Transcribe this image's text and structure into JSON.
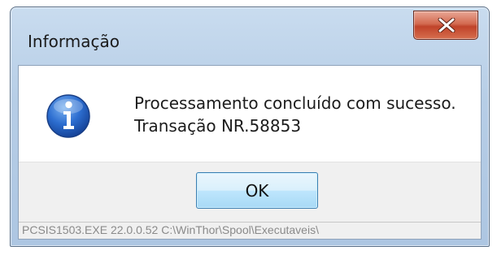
{
  "dialog": {
    "title": "Informação",
    "icon": "information-icon",
    "message_line1": "Processamento concluído com sucesso.",
    "message_line2": "Transação NR.58853",
    "ok_label": "OK",
    "status_text": "PCSIS1503.EXE 22.0.0.52 C:\\WinThor\\Spool\\Executaveis\\"
  },
  "colors": {
    "close_button": "#c7503a",
    "ok_button_border": "#3c7fb1",
    "info_icon": "#1f5fbf"
  }
}
